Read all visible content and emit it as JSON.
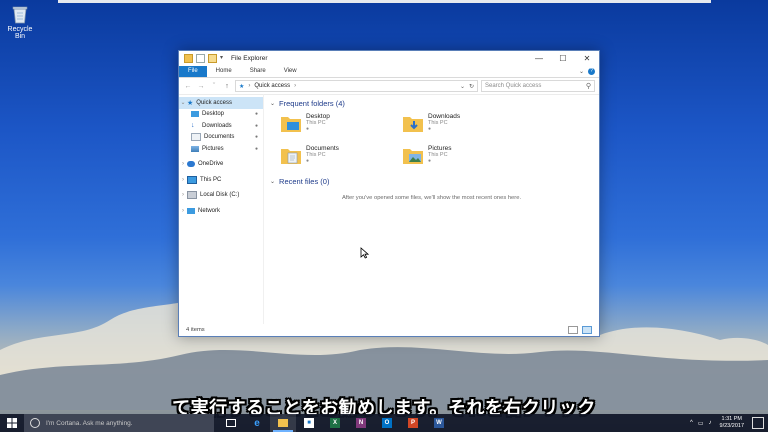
{
  "desktop": {
    "recycle_bin_label": "Recycle Bin"
  },
  "window": {
    "title": "File Explorer",
    "ribbon_tabs": [
      "File",
      "Home",
      "Share",
      "View"
    ],
    "address": {
      "breadcrumb": "Quick access",
      "search_placeholder": "Search Quick access"
    },
    "nav_pane": {
      "quick_access": "Quick access",
      "pinned": [
        "Desktop",
        "Downloads",
        "Documents",
        "Pictures"
      ],
      "onedrive": "OneDrive",
      "this_pc": "This PC",
      "local_disk": "Local Disk (C:)",
      "network": "Network"
    },
    "frequent_folders": {
      "heading": "Frequent folders (4)",
      "items": [
        {
          "name": "Desktop",
          "location": "This PC"
        },
        {
          "name": "Downloads",
          "location": "This PC"
        },
        {
          "name": "Documents",
          "location": "This PC"
        },
        {
          "name": "Pictures",
          "location": "This PC"
        }
      ]
    },
    "recent_files": {
      "heading": "Recent files (0)",
      "empty_message": "After you've opened some files, we'll show the most recent ones here."
    },
    "status": {
      "item_count": "4 items"
    }
  },
  "subtitle": "て実行することをお勧めします。それを右クリック",
  "taskbar": {
    "search_placeholder": "I'm Cortana. Ask me anything.",
    "apps": [
      "task-view",
      "edge",
      "file-explorer",
      "store",
      "excel",
      "onenote",
      "outlook",
      "powerpoint",
      "word"
    ],
    "clock_time": "1:31 PM",
    "clock_date": "9/23/2017"
  },
  "colors": {
    "accent": "#1979ca",
    "selection": "#cce4f7",
    "folder": "#f2c14e"
  }
}
